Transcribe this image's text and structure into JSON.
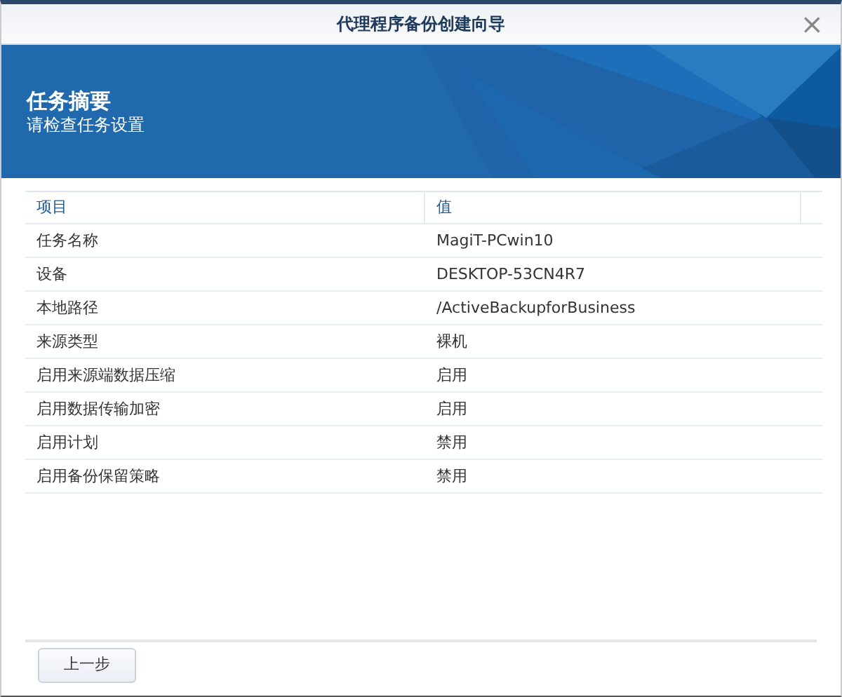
{
  "window": {
    "title": "代理程序备份创建向导",
    "close": "×"
  },
  "banner": {
    "title": "任务摘要",
    "subtitle": "请检查任务设置"
  },
  "table": {
    "columns": [
      "项目",
      "值"
    ],
    "rows": [
      [
        "任务名称",
        "MagiT-PCwin10"
      ],
      [
        "设备",
        "DESKTOP-53CN4R7"
      ],
      [
        "本地路径",
        "/ActiveBackupforBusiness"
      ],
      [
        "来源类型",
        "裸机"
      ],
      [
        "启用来源端数据压缩",
        "启用"
      ],
      [
        "启用数据传输加密",
        "启用"
      ],
      [
        "启用计划",
        "禁用"
      ],
      [
        "启用备份保留策略",
        "禁用"
      ]
    ]
  },
  "buttons": [
    "上一步"
  ]
}
